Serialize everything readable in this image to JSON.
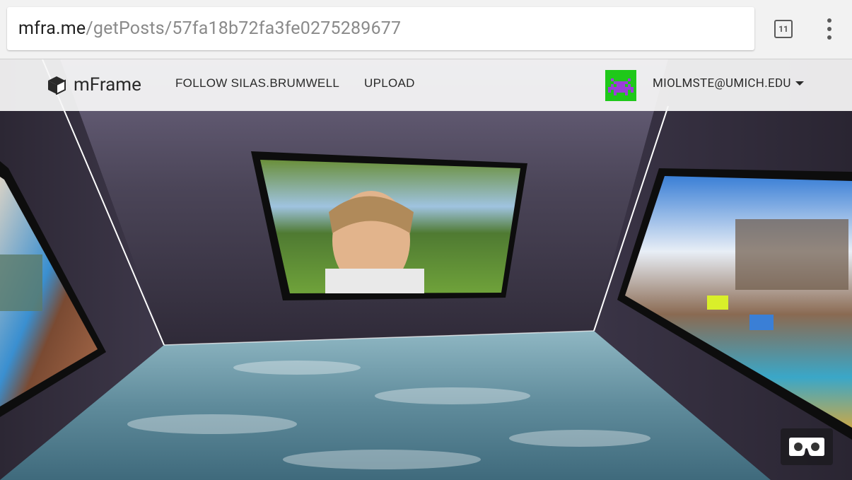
{
  "browser": {
    "url_host": "mfra.me",
    "url_path": "/getPosts/57fa18b72fa3fe0275289677",
    "tab_count": "11",
    "tabs_icon": "tab-switcher-icon",
    "menu_icon": "overflow-menu-icon"
  },
  "nav": {
    "brand": "mFrame",
    "brand_icon": "cube-icon",
    "follow_label": "FOLLOW SILAS.BRUMWELL",
    "upload_label": "UPLOAD",
    "user_email": "MIOLMSTE@UMICH.EDU",
    "avatar_icon": "space-invader-icon",
    "dropdown_icon": "caret-down-icon"
  },
  "scene": {
    "walls": "purple-stone-texture",
    "floor": "ocean-water-texture",
    "photos": [
      {
        "name": "left-photo",
        "description_icon": "photo-icon"
      },
      {
        "name": "center-photo",
        "description_icon": "photo-icon"
      },
      {
        "name": "right-photo",
        "description_icon": "photo-icon"
      }
    ]
  },
  "vr": {
    "icon": "cardboard-vr-icon"
  },
  "colors": {
    "avatar_bg": "#1fc81a",
    "avatar_fg": "#9b3fd9",
    "wall": "#4a4458",
    "floor": "#6c9aaa"
  }
}
